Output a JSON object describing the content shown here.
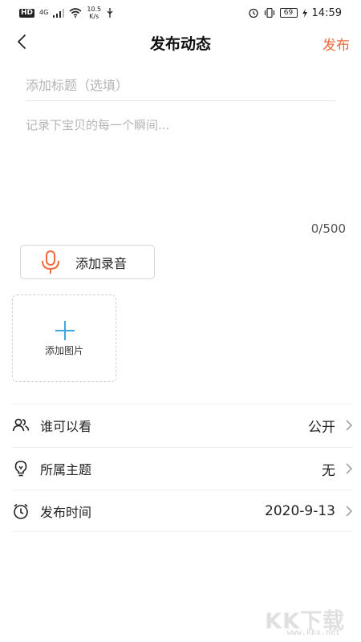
{
  "status_bar": {
    "hd": "HD",
    "network": "4G",
    "speed_value": "10.5",
    "speed_unit": "K/s",
    "battery": "69",
    "time": "14:59"
  },
  "header": {
    "title": "发布动态",
    "publish_label": "发布",
    "accent_color": "#f06a3c"
  },
  "form": {
    "title_placeholder": "添加标题（选填）",
    "content_placeholder": "记录下宝贝的每一个瞬间...",
    "char_count": "0/500",
    "add_audio_label": "添加录音",
    "add_image_label": "添加图片"
  },
  "options": [
    {
      "icon": "people-icon",
      "label": "谁可以看",
      "value": "公开"
    },
    {
      "icon": "bulb-icon",
      "label": "所属主题",
      "value": "无"
    },
    {
      "icon": "clock-icon",
      "label": "发布时间",
      "value": "2020-9-13"
    }
  ],
  "watermark": {
    "logo": "KK下载",
    "url": "www.kkx.net"
  }
}
